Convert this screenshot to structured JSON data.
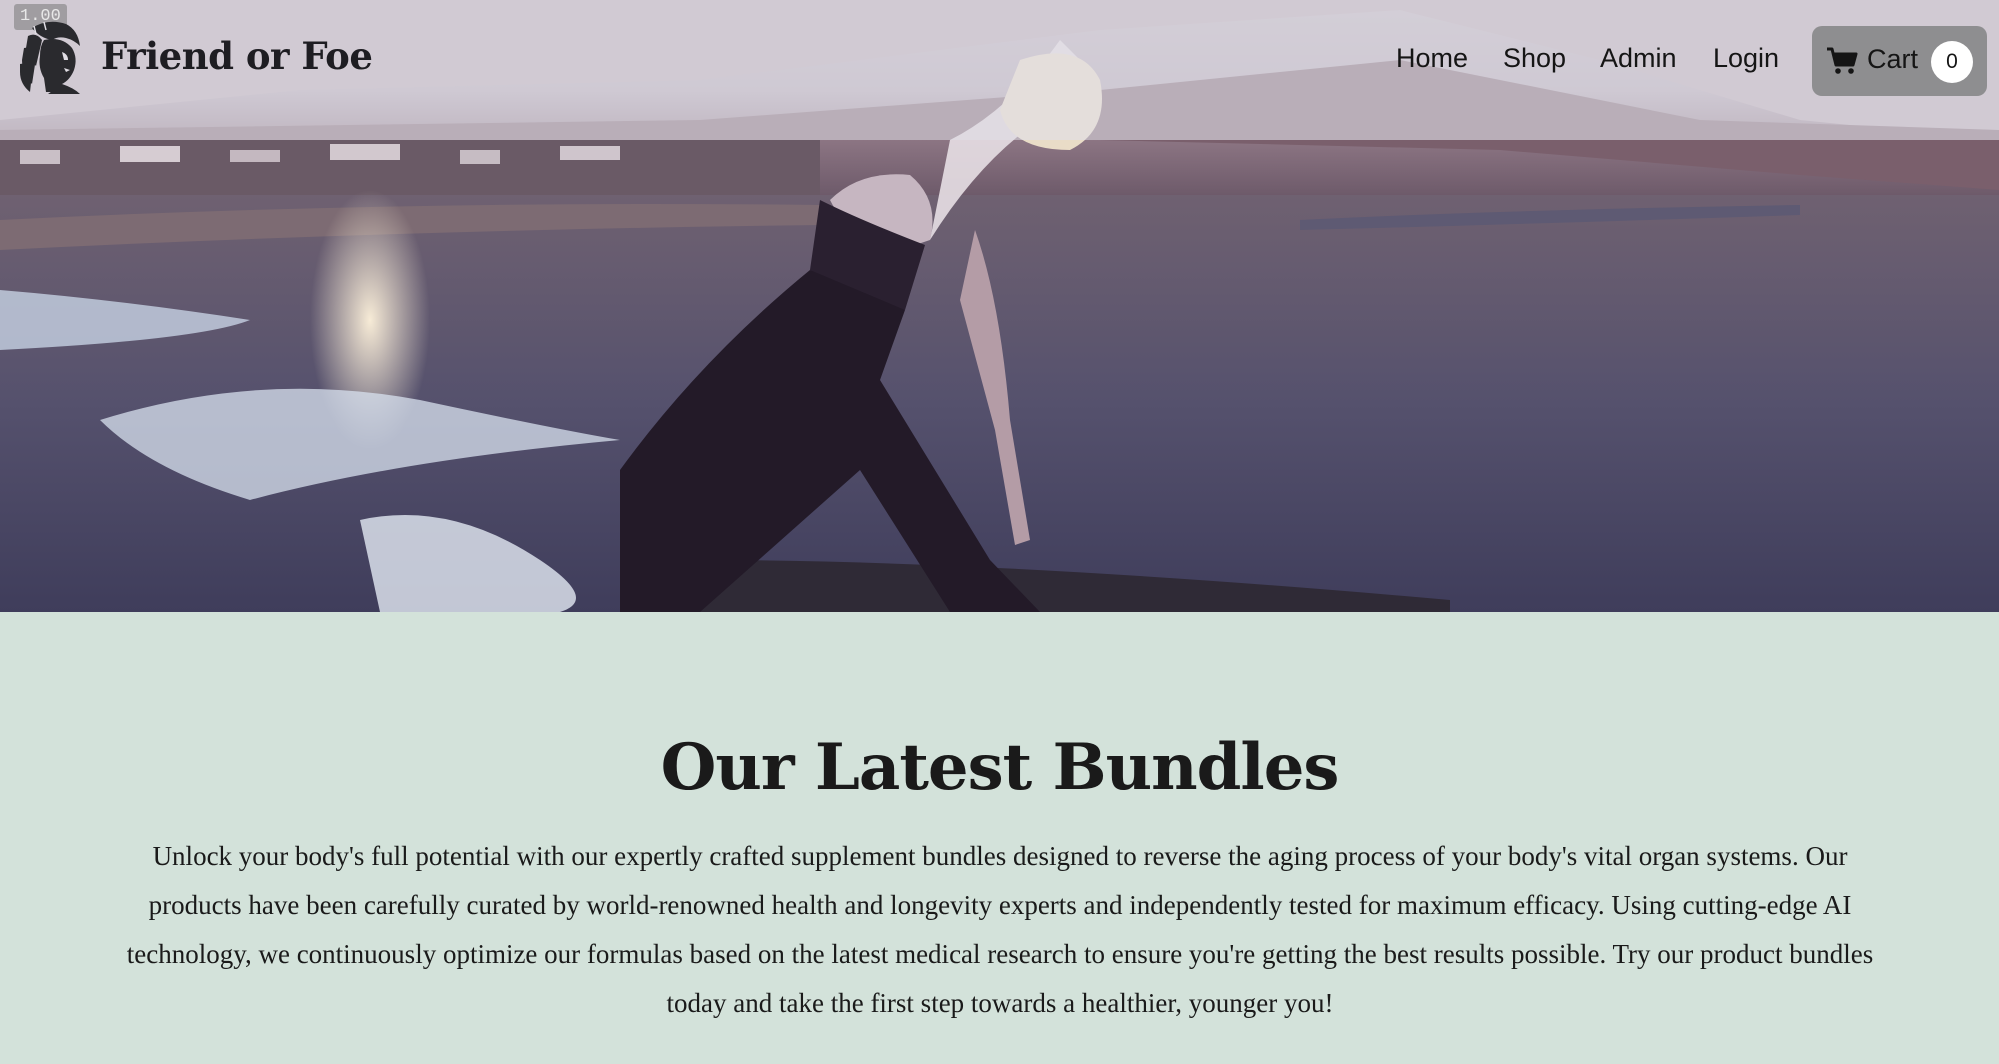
{
  "overlay": {
    "fps": "1.00"
  },
  "header": {
    "brand": "Friend or Foe",
    "logo_icon": "native-headdress-logo-icon",
    "nav": [
      {
        "label": "Home"
      },
      {
        "label": "Shop"
      },
      {
        "label": "Admin"
      },
      {
        "label": "Login"
      }
    ],
    "cart": {
      "label": "Cart",
      "count": "0",
      "icon": "shopping-cart-icon"
    }
  },
  "hero": {
    "media": "video background: woman stretching on rocks by the ocean at sunset"
  },
  "section": {
    "title": "Our Latest Bundles",
    "description": "Unlock your body's full potential with our expertly crafted supplement bundles designed to reverse the aging process of your body's vital organ systems. Our products have been carefully curated by world-renowned health and longevity experts and independently tested for maximum efficacy. Using cutting-edge AI technology, we continuously optimize our formulas based on the latest medical research to ensure you're getting the best results possible. Try our product bundles today and take the first step towards a healthier, younger you!"
  },
  "colors": {
    "content_background": "#d3e2da",
    "cart_background": "#8e8e90",
    "header_overlay": "#e1dee6"
  }
}
